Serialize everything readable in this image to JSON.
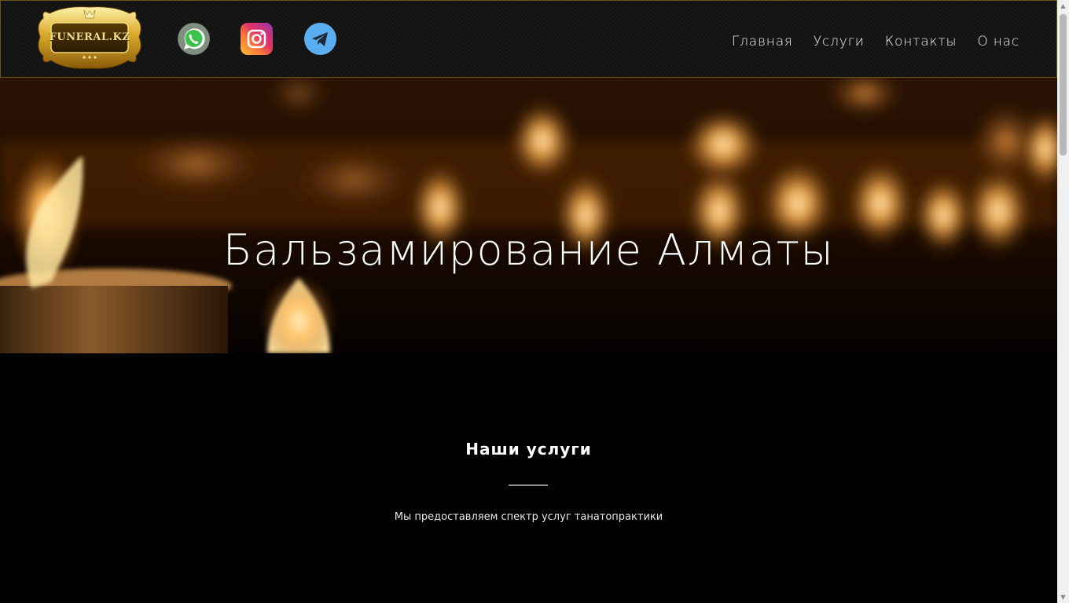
{
  "header": {
    "logo_text": "FUNERAL.KZ",
    "social": [
      {
        "name": "whatsapp",
        "icon": "whatsapp-icon"
      },
      {
        "name": "instagram",
        "icon": "instagram-icon"
      },
      {
        "name": "telegram",
        "icon": "telegram-icon"
      }
    ],
    "nav": [
      "Главная",
      "Услуги",
      "Контакты",
      "О нас"
    ]
  },
  "hero": {
    "title": "Бальзамирование Алматы"
  },
  "services": {
    "title": "Наши услуги",
    "subtitle": "Мы предоставляем спектр услуг танатопрактики"
  },
  "colors": {
    "gold": "#d4a93a",
    "header_bg": "#111111",
    "page_bg": "#000000"
  }
}
